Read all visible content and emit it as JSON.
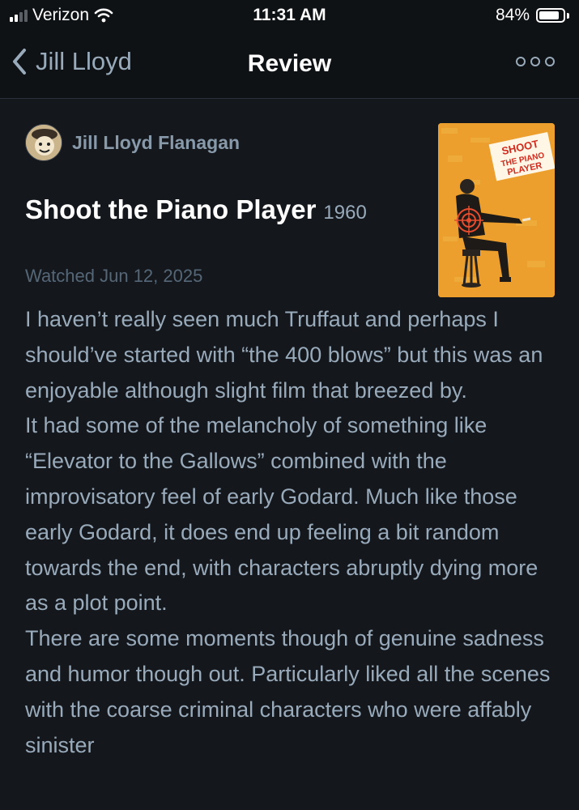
{
  "status_bar": {
    "carrier": "Verizon",
    "time": "11:31 AM",
    "battery_percent": "84%",
    "battery_level": 0.84
  },
  "nav": {
    "back_label": "Jill Lloyd",
    "title": "Review"
  },
  "reviewer": {
    "name": "Jill Lloyd Flanagan"
  },
  "film": {
    "title": "Shoot the Piano Player",
    "year": "1960",
    "poster_text": [
      "SHOOT",
      "THE PIANO",
      "PLAYER"
    ]
  },
  "watched": "Watched Jun 12, 2025",
  "review": {
    "paragraphs": [
      "I haven’t really seen much Truffaut and perhaps I should’ve started with “the 400 blows” but this was an enjoyable although slight film that breezed by.",
      "It had some of the melancholy of something like “Elevator to the Gallows” combined with the improvisatory feel of early Godard. Much like those early Godard, it does end up feeling a bit random towards the end, with characters abruptly dying more as a plot point.",
      "There are some moments though of genuine sadness and humor though out. Particularly liked all the scenes with the coarse criminal characters who were affably sinister"
    ]
  },
  "colors": {
    "background": "#14181c",
    "header": "#0f1215",
    "muted_text": "#99aabb",
    "reviewer_name": "#8899aa",
    "date_text": "#556677"
  }
}
